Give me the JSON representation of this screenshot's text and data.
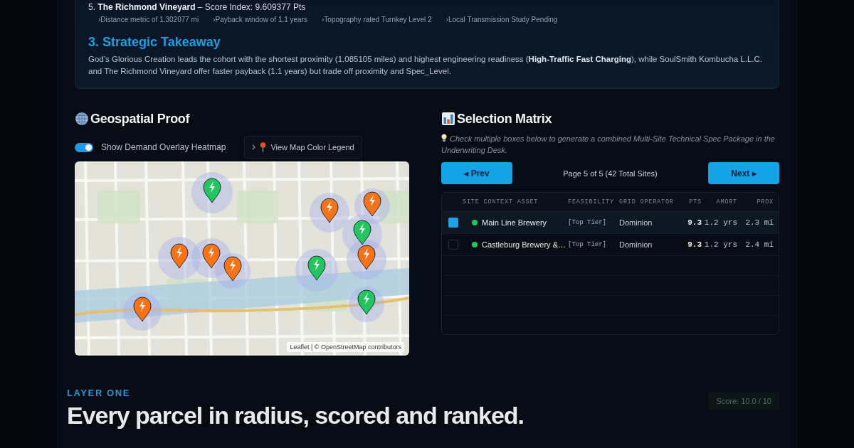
{
  "summary": {
    "ranked_item": "5. **The Richmond Vineyard** – Score Index: 9.609377 Pts",
    "details": [
      "›Distance metric of 1.302077 mi",
      "›Payback window of 1.1 years",
      "›Topography rated Turnkey Level 2",
      "›Local Transmission Study Pending"
    ],
    "section_title": "3. Strategic Takeaway",
    "takeaway": "God’s Glorious Creation leads the cohort with the shortest proximity (1.085105 miles) and highest engineering readiness (**High-Traffic Fast Charging**), while SoulSmith Kombucha L.L.C. and The Richmond Vineyard offer faster payback (1.1 years) but trade off proximity and Spec_Level."
  },
  "geospatial_proof": {
    "title": "Geospatial Proof",
    "heatmap_toggle": {
      "label": "Show Demand Overlay Heatmap",
      "on": true
    },
    "legend_button": {
      "label": "View Map Color Legend",
      "expanded": false
    },
    "map": {
      "markers": [
        {
          "color": "#22c55e"
        },
        {
          "color": "#f97316"
        },
        {
          "color": "#f97316"
        },
        {
          "color": "#22c55e"
        },
        {
          "color": "#f97316"
        },
        {
          "color": "#f97316"
        },
        {
          "color": "#f97316"
        },
        {
          "color": "#f97316"
        },
        {
          "color": "#22c55e"
        },
        {
          "color": "#22c55e"
        },
        {
          "color": "#f97316"
        }
      ],
      "attribution": "Leaflet | © OpenStreetMap contributors"
    }
  },
  "selection_matrix": {
    "title": "Selection Matrix",
    "hint": "Check multiple boxes below to generate a combined Multi-Site Technical Spec Package in the Underwriting Desk.",
    "prev_button": "◂ Prev",
    "page_info": "Page 5 of 5 (42 Total Sites)",
    "next_button": "Next ▸",
    "table": {
      "columns": [
        "SITE CONTEXT ASSET",
        "FEASIBILITY",
        "GRID OPERATOR",
        "PTS",
        "AMORT",
        "PROX"
      ],
      "rows": [
        {
          "checked": true,
          "color": "#22c55e",
          "site": "Main Line Brewery",
          "feasibility": "[Top Tier]",
          "grid_operator": "Dominion",
          "pts": "9.3",
          "amort": "1.2 yrs",
          "prox": "2.3 mi"
        },
        {
          "checked": false,
          "color": "#22c55e",
          "site": "Castleburg Brewery &…",
          "feasibility": "[Top Tier]",
          "grid_operator": "Dominion",
          "pts": "9.3",
          "amort": "1.2 yrs",
          "prox": "2.4 mi"
        }
      ]
    }
  },
  "underwriting_desk": {
    "score_badge": "Score: 10.0 / 10"
  },
  "caption": {
    "eyebrow": "LAYER ONE",
    "headline": "Every parcel in radius, scored and ranked."
  }
}
